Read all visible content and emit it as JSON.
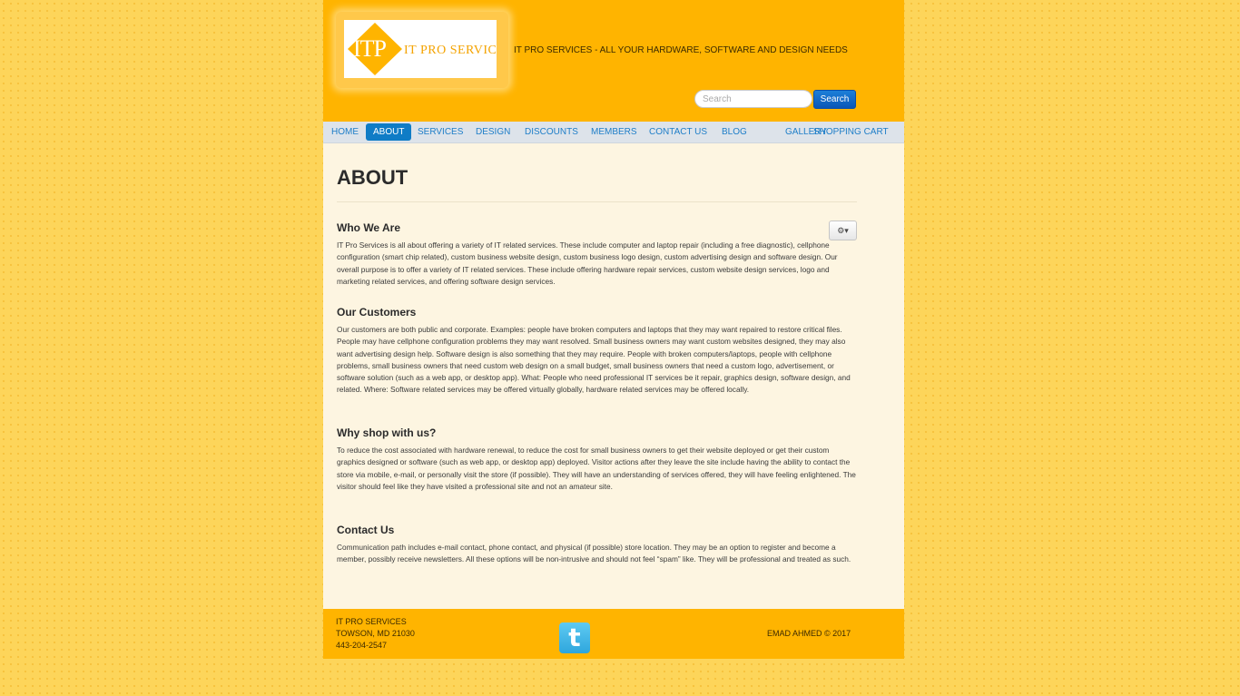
{
  "header": {
    "logo": {
      "mark": "ITP",
      "text": "IT PRO SERVICES"
    },
    "tagline": "IT PRO SERVICES - ALL YOUR HARDWARE, SOFTWARE AND DESIGN NEEDS",
    "search": {
      "placeholder": "Search",
      "button_label": "Search"
    }
  },
  "nav": {
    "items": [
      {
        "label": "HOME"
      },
      {
        "label": "ABOUT",
        "active": true
      },
      {
        "label": "SERVICES"
      },
      {
        "label": "DESIGN"
      },
      {
        "label": "DISCOUNTS"
      },
      {
        "label": "MEMBERS"
      },
      {
        "label": "CONTACT US"
      },
      {
        "label": "BLOG"
      },
      {
        "label": "GALLERY"
      },
      {
        "label": "SHOPPING CART"
      }
    ]
  },
  "main": {
    "title": "ABOUT",
    "gear_label": "⚙▾",
    "sections": [
      {
        "heading": "Who We Are",
        "text": "IT Pro Services is all about offering a variety of IT related services. These include computer and laptop repair (including a free diagnostic), cellphone configuration (smart chip related), custom business website design, custom business logo design, custom advertising design and software design. Our overall purpose  is to offer a variety of IT related services. These include offering hardware repair services, custom website design services, logo and marketing related services, and offering software design services."
      },
      {
        "heading": "Our Customers",
        "text": "Our customers are both public and corporate. Examples: people have broken computers and laptops that they may want repaired to restore critical files. People may have cellphone configuration problems they may want resolved. Small business owners may want custom websites designed, they may also want advertising design help. Software design is also something that they may require. People with broken computers/laptops, people with cellphone problems, small business owners that need custom web design on a small budget, small business owners that need a custom logo, advertisement, or software solution (such as a web app, or desktop app). What: People who need professional IT services be it repair, graphics design, software design, and related. Where: Software related services may be offered virtually globally, hardware related services may be offered locally."
      },
      {
        "heading": "Why shop with us?",
        "text": "To reduce the cost associated with hardware renewal, to reduce the cost for small business owners to get their website deployed or get their custom graphics designed or software (such as web app, or desktop app) deployed. Visitor actions after they leave the site include having the ability to contact the store via mobile, e-mail, or personally visit the store (if possible). They will have an understanding of services offered, they will have feeling enlightened. The visitor should feel like they have visited a professional site and not an amateur site."
      },
      {
        "heading": "Contact Us",
        "text": "Communication path includes e-mail contact, phone contact, and physical (if possible) store location. They may be an option to register and become a member, possibly receive newsletters. All these options will be non-intrusive and should not feel “spam” like. They will be professional and treated as such."
      }
    ]
  },
  "footer": {
    "address_lines": [
      "IT PRO SERVICES",
      "TOWSON, MD 21030",
      "443-204-2547"
    ],
    "twitter_glyph": "t",
    "copyright": "EMAD AHMED © 2017"
  },
  "colors": {
    "header_bg": "#ffb400",
    "content_bg": "#fdf5e1",
    "nav_active": "#0f7cc6",
    "link": "#1e7ec8"
  }
}
